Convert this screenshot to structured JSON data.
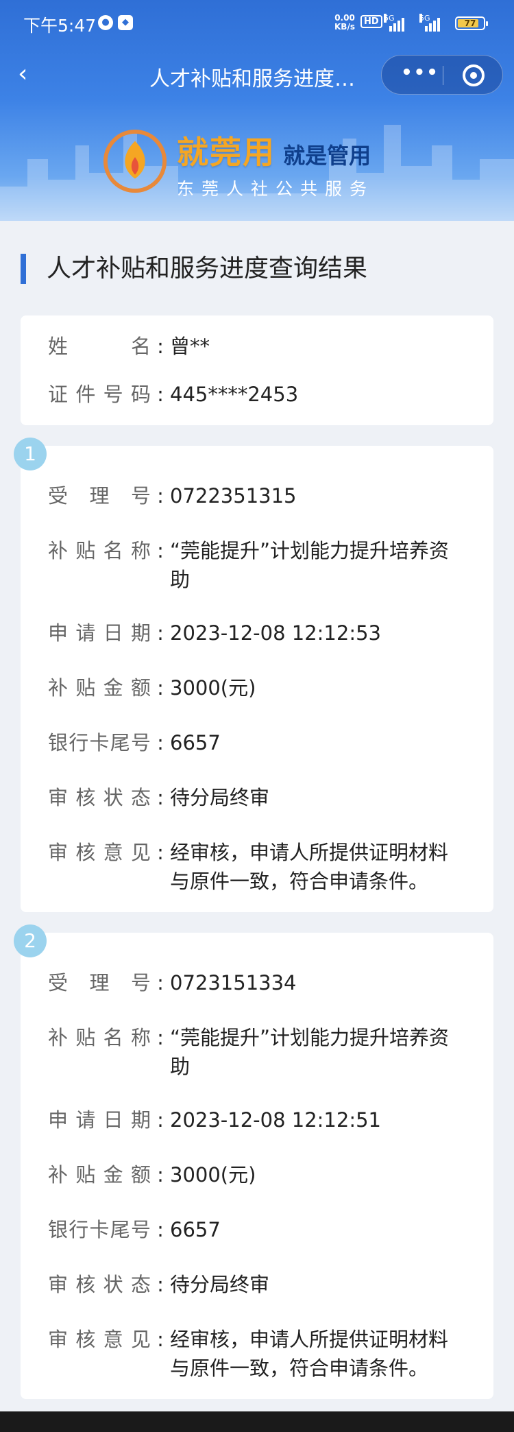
{
  "status_bar": {
    "time": "下午5:47",
    "net_speed_top": "0.00",
    "net_speed_bottom": "KB/s",
    "hd": "HD",
    "sim1": "5G",
    "sim2": "5G",
    "battery": "77"
  },
  "nav": {
    "back_glyph": "‹",
    "title": "人才补贴和服务进度…",
    "more_glyph": "•••"
  },
  "brand": {
    "name": "就莞用",
    "slogan": "就是管用",
    "subtitle": "东莞人社公共服务"
  },
  "section_title": "人才补贴和服务进度查询结果",
  "person": {
    "name_label": "姓名",
    "name_value": "曾**",
    "id_label": "证件号码",
    "id_value": "445****2453",
    "colon": ":"
  },
  "records": [
    {
      "index": "1",
      "fields": [
        {
          "label": "受理号",
          "value": "0722351315"
        },
        {
          "label": "补贴名称",
          "value": "“莞能提升”计划能力提升培养资助"
        },
        {
          "label": "申请日期",
          "value": "2023-12-08 12:12:53"
        },
        {
          "label": "补贴金额",
          "value": "3000(元)"
        },
        {
          "label": "银行卡尾号",
          "value": "6657"
        },
        {
          "label": "审核状态",
          "value": "待分局终审"
        },
        {
          "label": "审核意见",
          "value": "经审核，申请人所提供证明材料与原件一致，符合申请条件。"
        }
      ]
    },
    {
      "index": "2",
      "fields": [
        {
          "label": "受理号",
          "value": "0723151334"
        },
        {
          "label": "补贴名称",
          "value": "“莞能提升”计划能力提升培养资助"
        },
        {
          "label": "申请日期",
          "value": "2023-12-08 12:12:51"
        },
        {
          "label": "补贴金额",
          "value": "3000(元)"
        },
        {
          "label": "银行卡尾号",
          "value": "6657"
        },
        {
          "label": "审核状态",
          "value": "待分局终审"
        },
        {
          "label": "审核意见",
          "value": "经审核，申请人所提供证明材料与原件一致，符合申请条件。"
        }
      ]
    }
  ],
  "colors": {
    "primary": "#2f6fd6",
    "badge": "#9bd3ee",
    "brand_orange": "#f5a623"
  }
}
